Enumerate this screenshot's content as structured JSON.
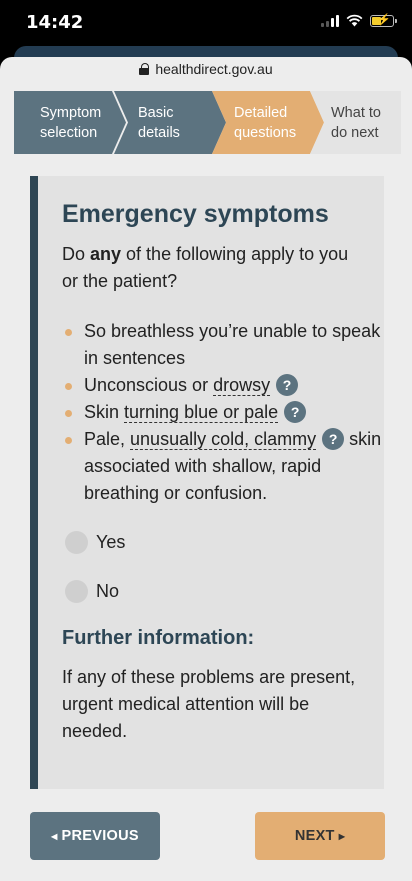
{
  "status_bar": {
    "time": "14:42"
  },
  "browser": {
    "url": "healthdirect.gov.au"
  },
  "steps": [
    {
      "line1": "Symptom",
      "line2": "selection",
      "state": "completed"
    },
    {
      "line1": "Basic",
      "line2": "details",
      "state": "completed"
    },
    {
      "line1": "Detailed",
      "line2": "questions",
      "state": "current"
    },
    {
      "line1": "What to",
      "line2": "do next",
      "state": "upcoming"
    }
  ],
  "card": {
    "title": "Emergency symptoms",
    "question_pre": "Do ",
    "question_bold": "any",
    "question_post": " of the following apply to you or the patient?",
    "symptoms": {
      "s1": "So breathless you’re unable to speak in sentences",
      "s2_pre": "Unconscious or ",
      "s2_term": "drowsy",
      "s3_pre": "Skin ",
      "s3_term": "turning blue or pale",
      "s4_pre": "Pale, ",
      "s4_term": "unusually cold, clammy",
      "s4_post": " skin associated with shallow, rapid breathing or confusion."
    },
    "help_symbol": "?",
    "options": {
      "yes": "Yes",
      "no": "No"
    },
    "further_title": "Further information:",
    "further_text": "If any of these problems are present, urgent medical attention will be needed."
  },
  "buttons": {
    "previous": "PREVIOUS",
    "next": "NEXT",
    "prev_arrow": "◀",
    "next_arrow": "▶"
  },
  "colors": {
    "step_done": "#5c7380",
    "step_current": "#e3ae73",
    "step_upcoming": "#e4e4e4",
    "card_accent": "#2f4654",
    "bullet": "#e3ae73"
  }
}
